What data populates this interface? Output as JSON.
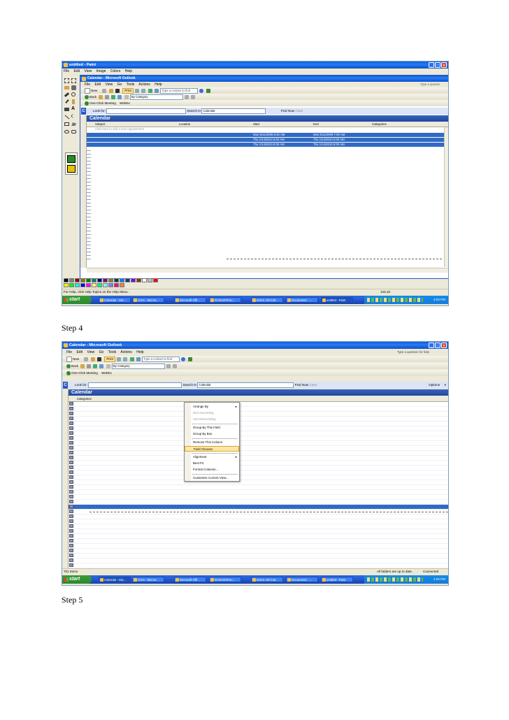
{
  "step4_label": "Step 4",
  "step5_label": "Step 5",
  "shot1": {
    "paint_title": "untitled - Paint",
    "paint_menu": [
      "File",
      "Edit",
      "View",
      "Image",
      "Colors",
      "Help"
    ],
    "outlook_title": "Calendar - Microsoft Outlook",
    "outlook_menu": [
      "File",
      "Edit",
      "View",
      "Go",
      "Tools",
      "Actions",
      "Help"
    ],
    "help_placeholder": "Type a questio",
    "toolbar1": {
      "new": "New",
      "print": "Print",
      "contact_placeholder": "Type a contact to find"
    },
    "toolbar2": {
      "back": "Back",
      "category": "By Category"
    },
    "toolbar3": {
      "one_click": "One-Click Meeting",
      "webex": "WebEx"
    },
    "find": {
      "look_for": "Look for:",
      "search_in": "Search In",
      "scope": "Calendar",
      "find_now": "Find Now",
      "clear": "Clear"
    },
    "calendar_header": "Calendar",
    "columns": {
      "subject": "Subject",
      "location": "Location",
      "start": "Start",
      "end": "End",
      "categories": "Categories"
    },
    "new_item_hint": "Click here to add a new Appointment",
    "rows": [
      {
        "start": "Mon 5/11/2009 6:30 AM",
        "end": "Mon 5/11/2009 7:00 AM"
      },
      {
        "start": "Thu 1/14/2010 5:00 AM",
        "end": "Thu 1/14/2010 6:00 AM"
      },
      {
        "start": "Thu 1/14/2010 8:00 AM",
        "end": "Thu 1/14/2010 9:00 AM"
      }
    ],
    "status_help": "For Help, click Help Topics on the Help Menu.",
    "status_coords": "126,33",
    "taskbar": {
      "start": "start",
      "tasks": [
        "Calendar - Mic...",
        "CISA - Micros...",
        "Microsoft Offi...",
        "W:\\DAD\\Proc...",
        "Dolcic Old Cal...",
        "Document1 - ...",
        "untitled - Paint"
      ],
      "clock": "4:03 PM"
    },
    "palette_colors": [
      "#000000",
      "#808080",
      "#800000",
      "#808000",
      "#008000",
      "#008080",
      "#000080",
      "#800080",
      "#808040",
      "#004040",
      "#0080ff",
      "#004080",
      "#8000ff",
      "#804000",
      "#ffffff",
      "#c0c0c0",
      "#ff0000",
      "#ffff00",
      "#00ff00",
      "#00ffff",
      "#0000ff",
      "#ff00ff",
      "#ffff80",
      "#00ff80",
      "#80ffff",
      "#8080ff",
      "#ff0080",
      "#ff8040"
    ]
  },
  "shot2": {
    "outlook_title": "Calendar - Microsoft Outlook",
    "outlook_menu": [
      "File",
      "Edit",
      "View",
      "Go",
      "Tools",
      "Actions",
      "Help"
    ],
    "help_placeholder": "Type a question for help",
    "toolbar1": {
      "new": "New",
      "print": "Print",
      "contact_placeholder": "Type a contact to find"
    },
    "toolbar2": {
      "back": "Back",
      "category": "By Category"
    },
    "toolbar3": {
      "one_click": "One-Click Meeting",
      "webex": "WebEx"
    },
    "find": {
      "look_for": "Look for:",
      "search_in": "Search In",
      "scope": "Calendar",
      "find_now": "Find Now",
      "clear": "Clear",
      "options": "Options"
    },
    "calendar_header": "Calendar",
    "column_header": "Categories",
    "context_menu": [
      {
        "label": "Arrange By",
        "sub": true,
        "disabled": false
      },
      {
        "label": "Sort Ascending",
        "disabled": true
      },
      {
        "label": "Sort Descending",
        "disabled": true
      },
      {
        "label": "Group By This Field",
        "disabled": false,
        "sep_before": true
      },
      {
        "label": "Group By Box",
        "disabled": false
      },
      {
        "label": "Remove This Column",
        "disabled": false,
        "sep_before": true
      },
      {
        "label": "Field Chooser",
        "disabled": false,
        "highlight": true
      },
      {
        "label": "Alignment",
        "sub": true,
        "disabled": false,
        "sep_before": true
      },
      {
        "label": "Best Fit",
        "disabled": false
      },
      {
        "label": "Format Columns...",
        "disabled": false
      },
      {
        "label": "Customize Current View...",
        "disabled": false,
        "sep_before": true
      }
    ],
    "status_items": "701 Items",
    "status_sync": "All folders are up to date.",
    "status_conn": "Connected",
    "taskbar": {
      "start": "start",
      "tasks": [
        "Calendar - Mic...",
        "CISA - Micros...",
        "Microsoft Offi...",
        "W:\\DAD\\Proc...",
        "Dolcic Old Cal...",
        "Document1 - ...",
        "untitled - Paint"
      ],
      "clock": "4:03 PM"
    }
  }
}
